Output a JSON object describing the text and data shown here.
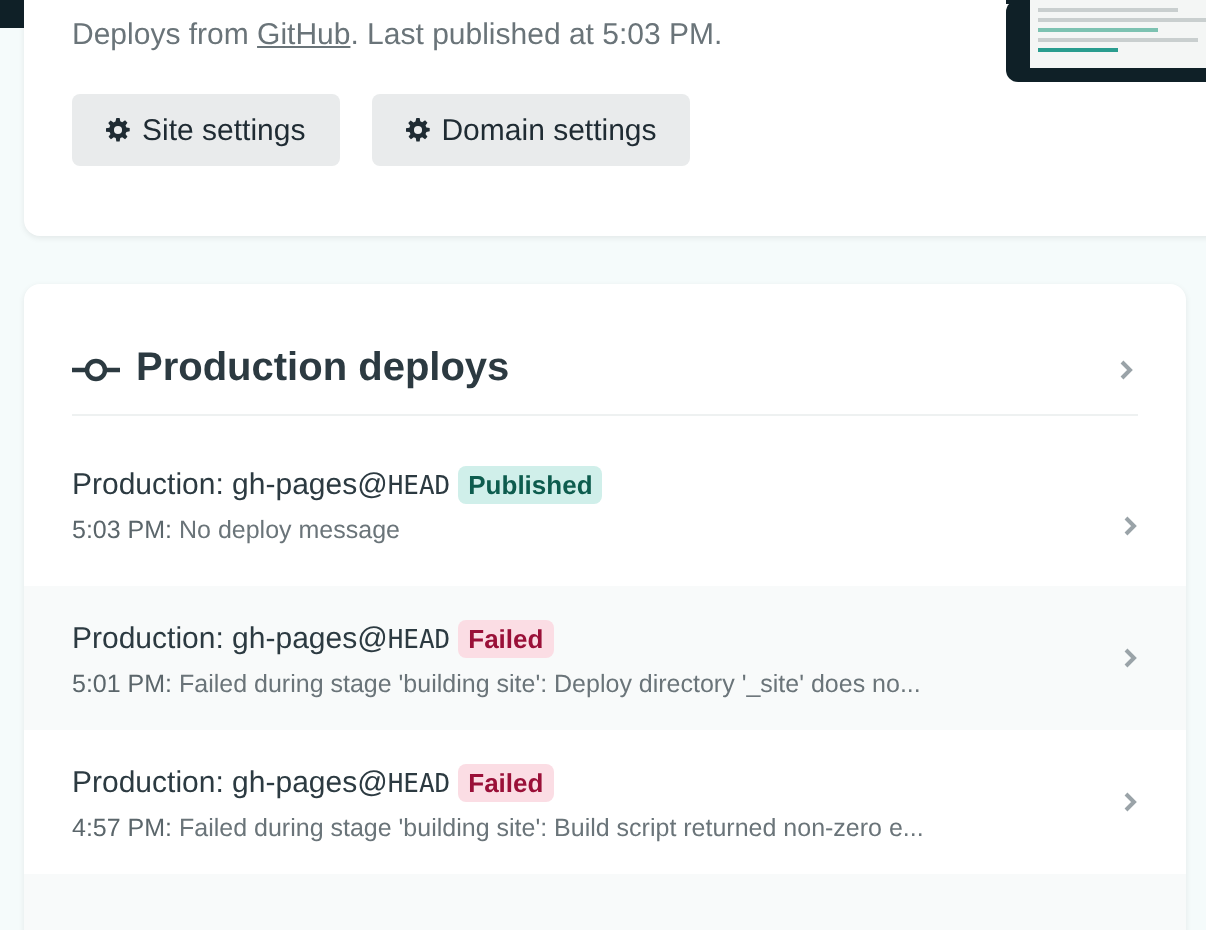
{
  "site_card": {
    "description": {
      "before": "Deploys from ",
      "link": "GitHub",
      "after": ". Last published at 5:03 PM."
    },
    "preview": {
      "kind": "picture"
    },
    "buttons": [
      "Site settings",
      "Domain settings"
    ]
  },
  "deploys_card": {
    "title": "Production deploys",
    "rows": [
      {
        "context": "Production: gh-pages@",
        "ref": "HEAD",
        "kind": "published",
        "badge": "Published",
        "time": "5:03 PM:",
        "message": "No deploy message"
      },
      {
        "context": "Production: gh-pages@",
        "ref": "HEAD",
        "kind": "failed",
        "badge": "Failed",
        "time": "5:01 PM:",
        "message": "Failed during stage 'building site': Deploy directory '_site' does no..."
      },
      {
        "context": "Production: gh-pages@",
        "ref": "HEAD",
        "kind": "failed",
        "badge": "Failed",
        "time": "4:57 PM:",
        "message": "Failed during stage 'building site': Build script returned non-zero e..."
      }
    ]
  }
}
